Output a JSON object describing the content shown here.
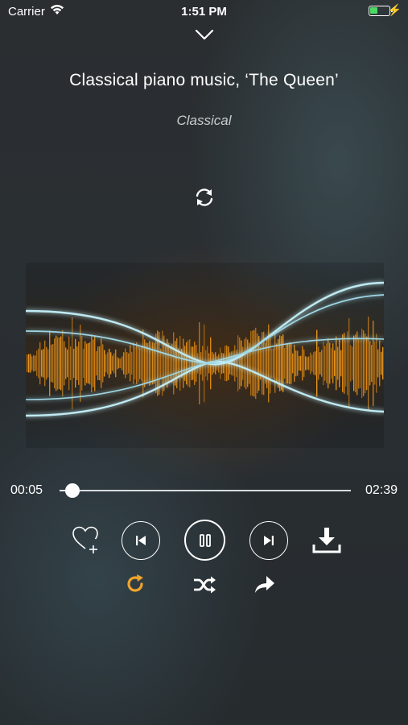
{
  "status_bar": {
    "carrier": "Carrier",
    "time": "1:51 PM"
  },
  "track": {
    "title": "Classical piano music, ‘The Queen’",
    "genre": "Classical"
  },
  "progress": {
    "elapsed": "00:05",
    "total": "02:39",
    "fraction": 0.045
  },
  "controls": {
    "icons": [
      "chevron-down-icon",
      "rotate-icon",
      "heart-add-icon",
      "previous-icon",
      "pause-icon",
      "next-icon",
      "download-icon",
      "repeat-icon",
      "shuffle-icon",
      "share-icon"
    ],
    "repeat_active_color": "#f0a52c"
  },
  "colors": {
    "accent": "#f0a52c",
    "text": "#ffffff"
  }
}
